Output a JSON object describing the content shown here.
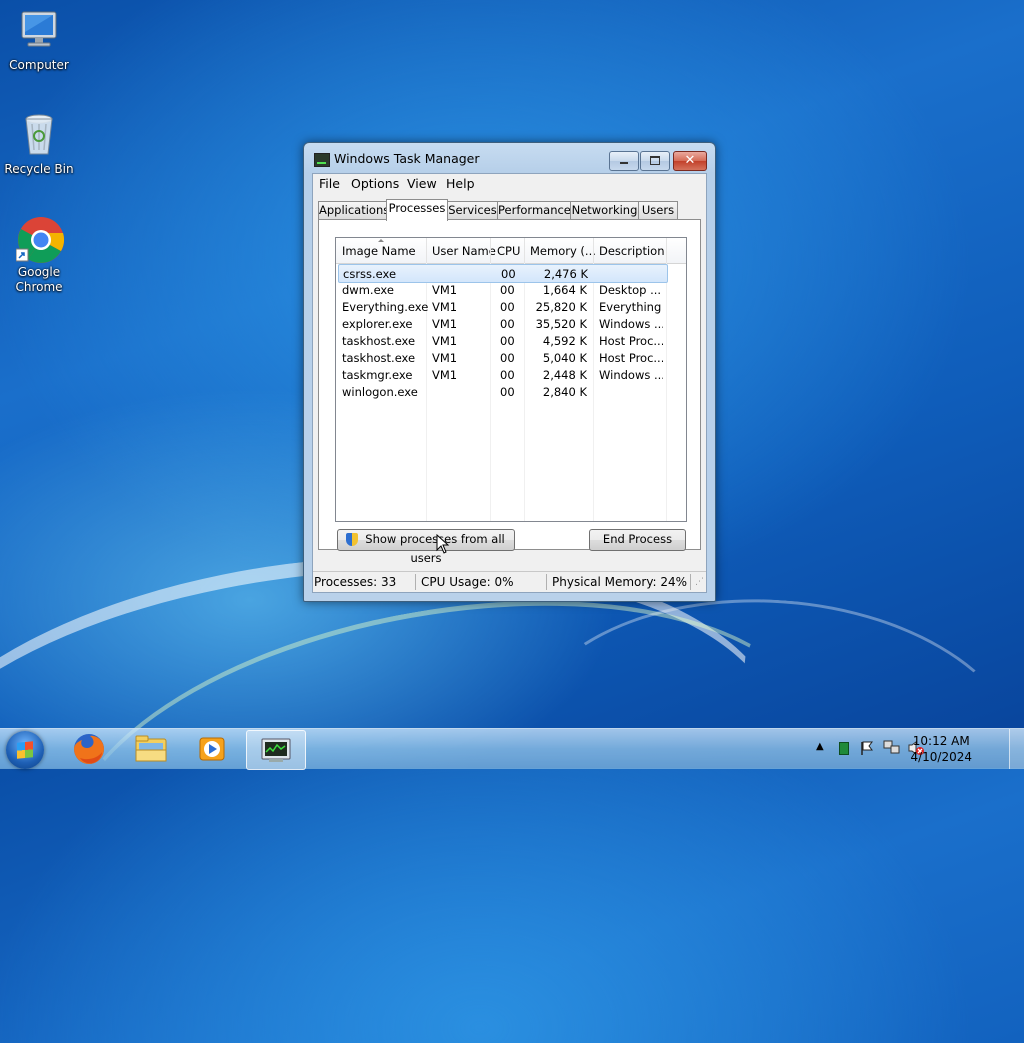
{
  "desktop": {
    "icons": [
      {
        "label": "Computer"
      },
      {
        "label": "Recycle Bin"
      },
      {
        "label": "Google\nChrome"
      }
    ]
  },
  "window": {
    "title": "Windows Task Manager",
    "menu": [
      "File",
      "Options",
      "View",
      "Help"
    ],
    "tabs": [
      "Applications",
      "Processes",
      "Services",
      "Performance",
      "Networking",
      "Users"
    ],
    "active_tab": "Processes",
    "columns": [
      "Image Name",
      "User Name",
      "CPU",
      "Memory (...",
      "Description"
    ],
    "processes": [
      {
        "image": "csrss.exe",
        "user": "",
        "cpu": "00",
        "memory": "2,476 K",
        "desc": ""
      },
      {
        "image": "dwm.exe",
        "user": "VM1",
        "cpu": "00",
        "memory": "1,664 K",
        "desc": "Desktop ..."
      },
      {
        "image": "Everything.exe",
        "user": "VM1",
        "cpu": "00",
        "memory": "25,820 K",
        "desc": "Everything"
      },
      {
        "image": "explorer.exe",
        "user": "VM1",
        "cpu": "00",
        "memory": "35,520 K",
        "desc": "Windows ..."
      },
      {
        "image": "taskhost.exe",
        "user": "VM1",
        "cpu": "00",
        "memory": "4,592 K",
        "desc": "Host Proc..."
      },
      {
        "image": "taskhost.exe",
        "user": "VM1",
        "cpu": "00",
        "memory": "5,040 K",
        "desc": "Host Proc..."
      },
      {
        "image": "taskmgr.exe",
        "user": "VM1",
        "cpu": "00",
        "memory": "2,448 K",
        "desc": "Windows ..."
      },
      {
        "image": "winlogon.exe",
        "user": "",
        "cpu": "00",
        "memory": "2,840 K",
        "desc": ""
      }
    ],
    "selected_row": 0,
    "show_all_label": "Show processes from all users",
    "end_process_label": "End Process",
    "status": {
      "processes": "Processes: 33",
      "cpu": "CPU Usage: 0%",
      "memory": "Physical Memory: 24%"
    }
  },
  "taskbar": {
    "pinned": [
      "firefox-icon",
      "explorer-icon",
      "media-player-icon",
      "task-manager-icon"
    ],
    "clock_time": "10:12 AM",
    "clock_date": "4/10/2024"
  }
}
